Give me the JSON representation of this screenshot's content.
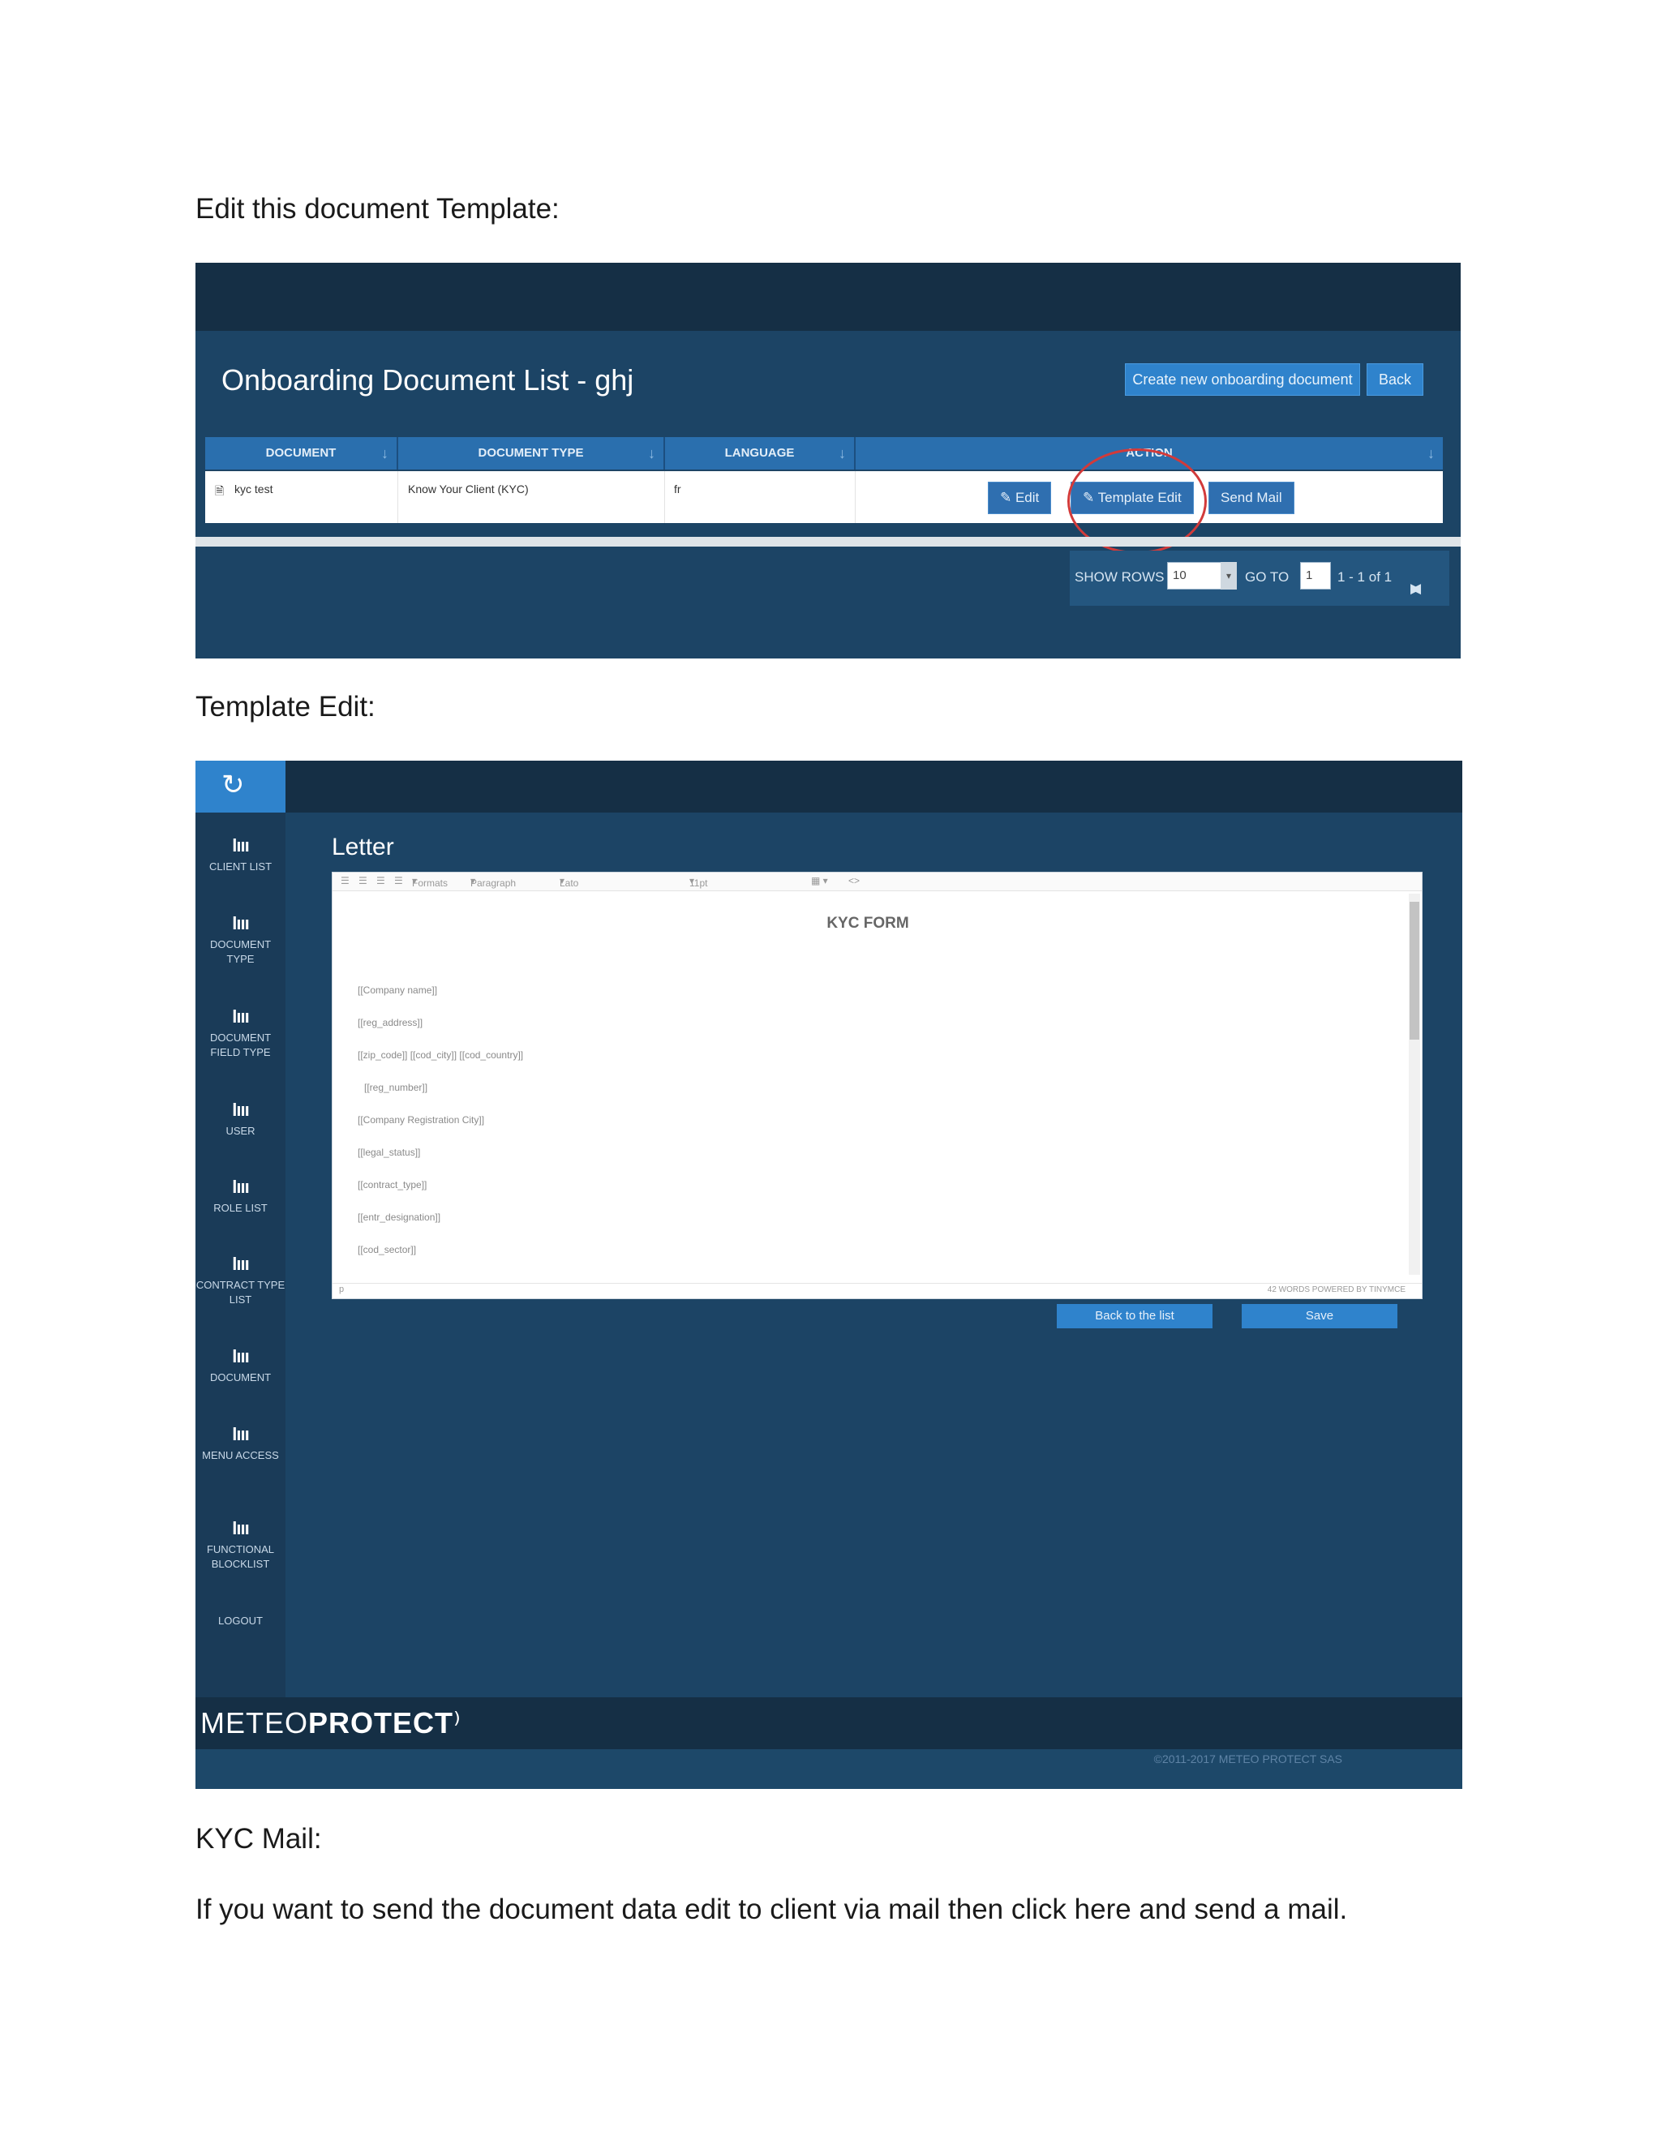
{
  "doc": {
    "heading1": "Edit this document Template:",
    "heading2": "Template Edit:",
    "heading3": "KYC Mail:",
    "paragraph": "If you want to send the document data edit to client via mail then click here and send a mail."
  },
  "shot1": {
    "title": "Onboarding Document List - ghj",
    "create_button": "Create new onboarding document",
    "back_button": "Back",
    "columns": [
      "DOCUMENT",
      "DOCUMENT TYPE",
      "LANGUAGE",
      "ACTION"
    ],
    "row": {
      "document": "kyc test",
      "document_type": "Know Your Client (KYC)",
      "language": "fr"
    },
    "actions": {
      "edit": "Edit",
      "template_edit": "Template Edit",
      "send_mail": "Send Mail"
    },
    "pager": {
      "show_rows_label": "SHOW ROWS",
      "rows": "10",
      "goto_label": "GO TO",
      "page": "1",
      "range": "1 - 1 of 1"
    },
    "highlight_color": "#d23a3a"
  },
  "shot2": {
    "sidebar": [
      {
        "label": "CLIENT LIST"
      },
      {
        "label": "DOCUMENT TYPE"
      },
      {
        "label": "DOCUMENT FIELD TYPE"
      },
      {
        "label": "USER"
      },
      {
        "label": "ROLE LIST"
      },
      {
        "label": "CONTRACT TYPE LIST"
      },
      {
        "label": "DOCUMENT"
      },
      {
        "label": "MENU ACCESS"
      },
      {
        "label": "FUNCTIONAL BLOCKLIST"
      }
    ],
    "logout": "LOGOUT",
    "page_title": "Letter",
    "toolbar": {
      "formats": "Formats",
      "paragraph": "Paragraph",
      "font": "Lato",
      "size": "11pt",
      "code": "<>"
    },
    "form_title": "KYC FORM",
    "fields": [
      "[[Company name]]",
      "[[reg_address]]",
      "[[zip_code]] [[cod_city]] [[cod_country]]",
      "[[reg_number]]",
      "[[Company Registration City]]",
      "[[legal_status]]",
      "[[contract_type]]",
      "[[entr_designation]]",
      "[[cod_sector]]"
    ],
    "status_left": "p",
    "status_right": "42 WORDS POWERED BY TINYMCE",
    "back_to_list": "Back to the list",
    "save": "Save",
    "brand_light": "METEO",
    "brand_bold": "PROTECT",
    "copyright": "©2011-2017 METEO PROTECT SAS"
  }
}
